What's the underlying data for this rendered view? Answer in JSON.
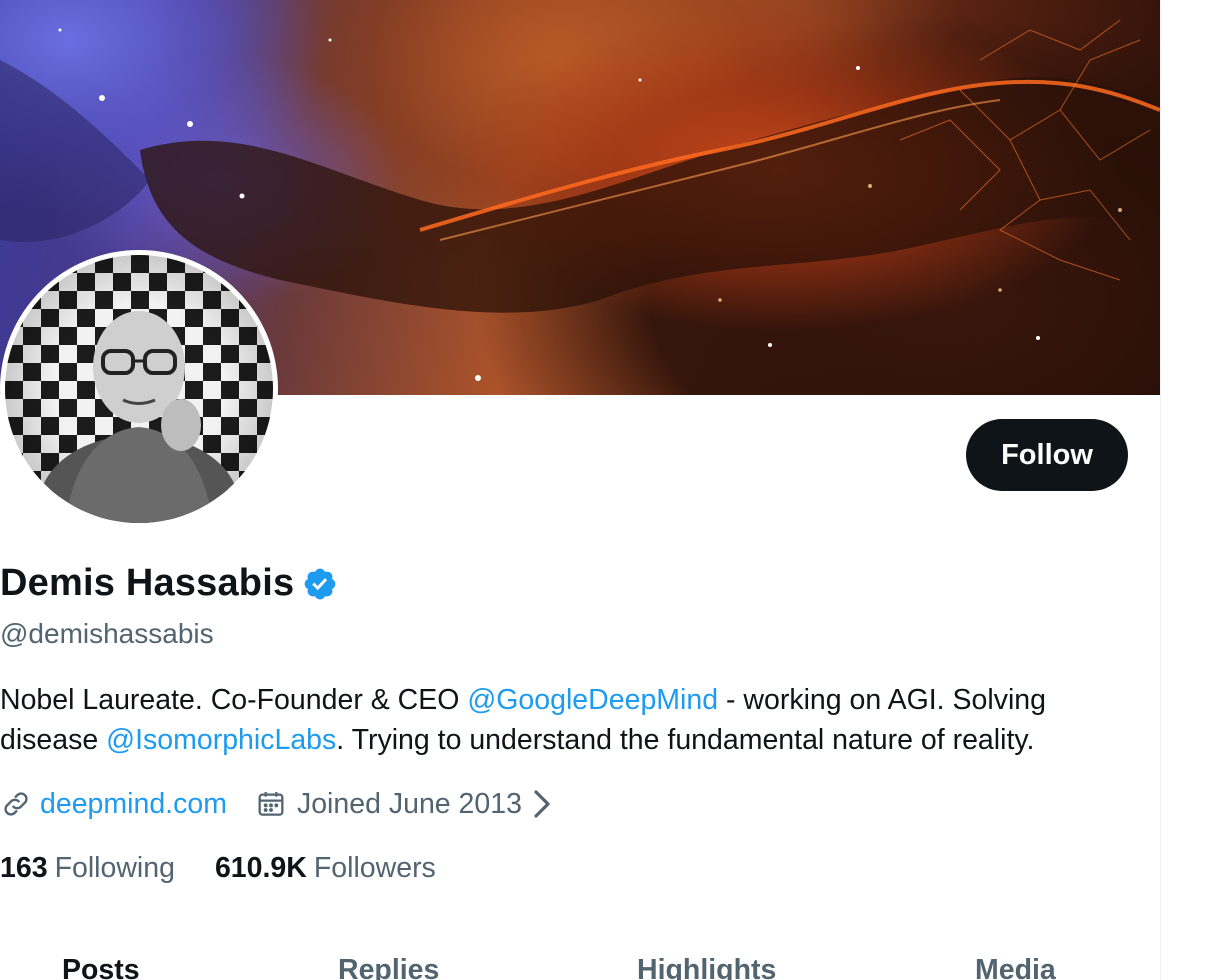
{
  "profile": {
    "name": "Demis Hassabis",
    "handle": "@demishassabis",
    "bio": {
      "part1": "Nobel Laureate. Co-Founder & CEO ",
      "mention1": "@GoogleDeepMind",
      "part2": " - working on AGI. Solving disease ",
      "mention2": "@IsomorphicLabs",
      "part3": ". Trying to understand the fundamental nature of reality."
    },
    "website": "deepmind.com",
    "joined": "Joined June 2013",
    "following_count": "163",
    "following_label": "Following",
    "followers_count": "610.9K",
    "followers_label": "Followers"
  },
  "actions": {
    "follow_label": "Follow"
  },
  "tabs": [
    {
      "label": "Posts",
      "active": true
    },
    {
      "label": "Replies",
      "active": false
    },
    {
      "label": "Highlights",
      "active": false
    },
    {
      "label": "Media",
      "active": false
    }
  ],
  "colors": {
    "accent": "#1d9bf0",
    "text_primary": "#0f1419",
    "text_secondary": "#536471",
    "button_bg": "#0f1419"
  },
  "icons": {
    "verified": "verified-badge-icon",
    "link": "link-icon",
    "calendar": "calendar-icon",
    "chevron": "chevron-right-icon"
  }
}
